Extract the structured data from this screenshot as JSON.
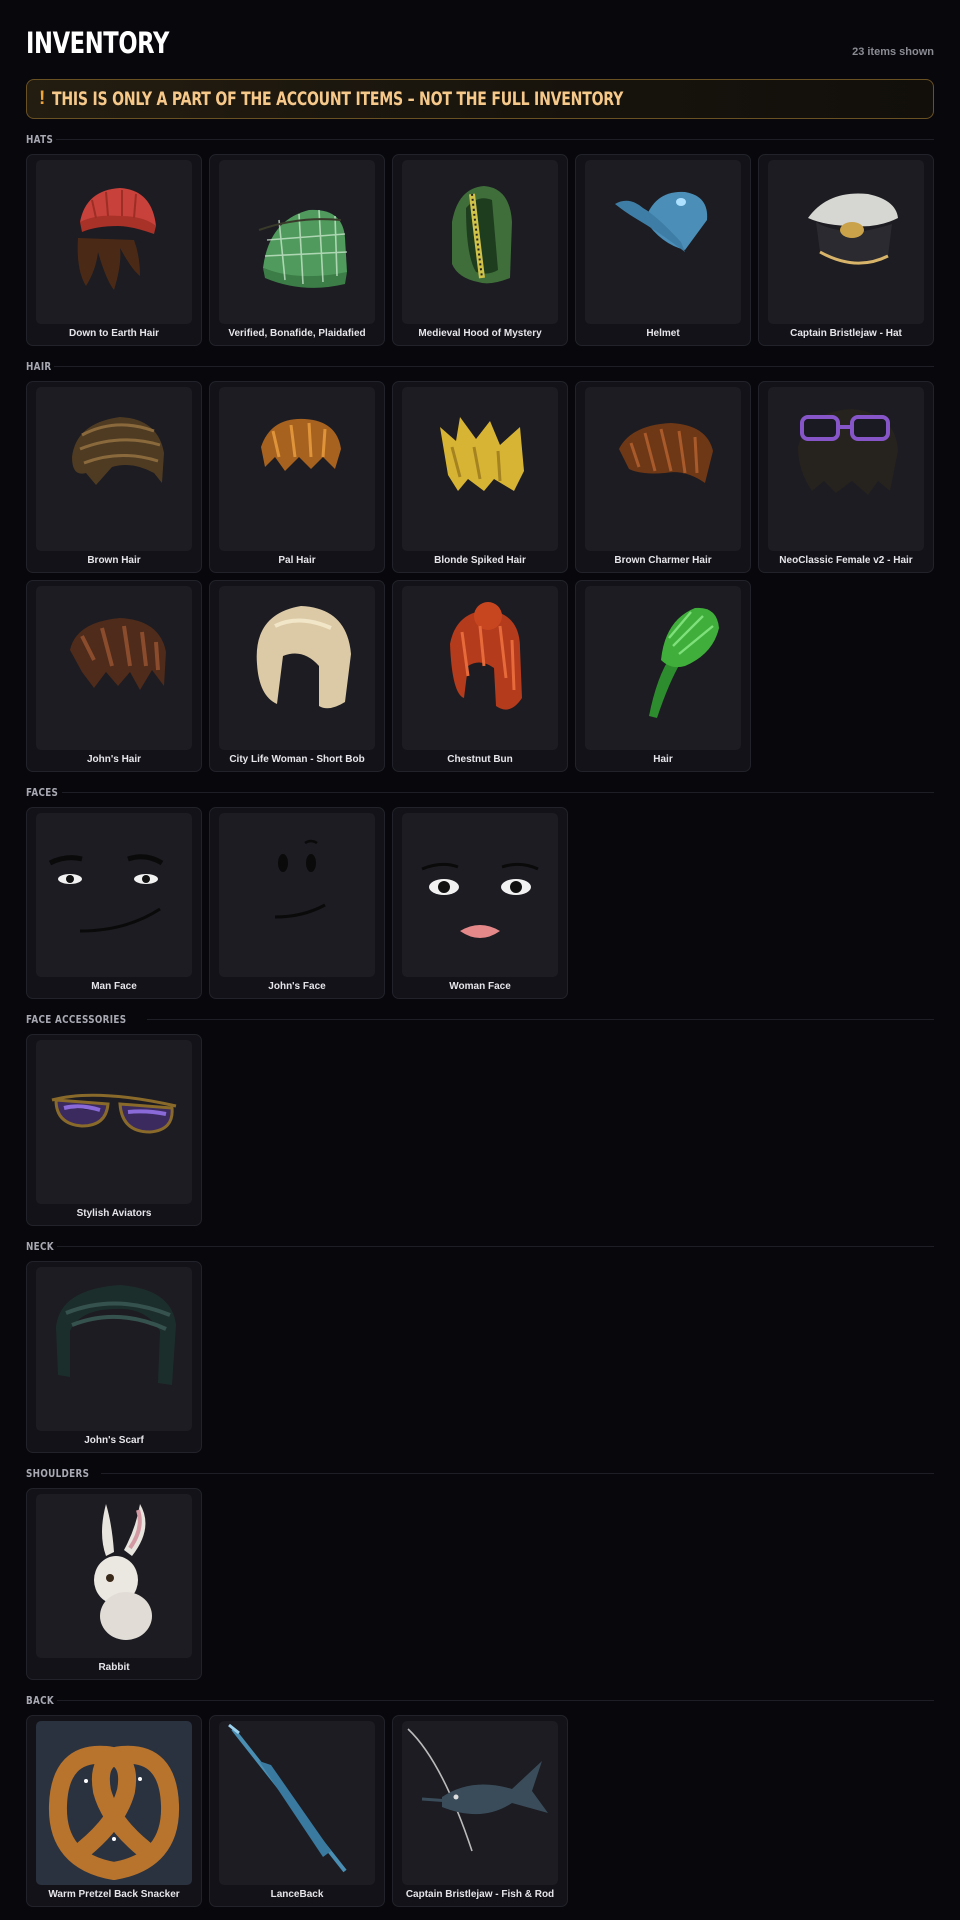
{
  "header": {
    "title": "INVENTORY",
    "count": "23 items shown"
  },
  "banner": {
    "icon": "!",
    "message": "THIS IS ONLY A PART OF THE ACCOUNT ITEMS – NOT THE FULL INVENTORY"
  },
  "sections": [
    {
      "label": "HATS",
      "items": [
        {
          "name": "Down to Earth Hair",
          "icon": "red-beanie-hair-icon"
        },
        {
          "name": "Verified, Bonafide, Plaidafied",
          "icon": "plaid-cap-icon"
        },
        {
          "name": "Medieval Hood of Mystery",
          "icon": "green-hood-icon"
        },
        {
          "name": "Helmet",
          "icon": "blue-helmet-icon"
        },
        {
          "name": "Captain Bristlejaw - Hat",
          "icon": "captain-hat-icon"
        }
      ]
    },
    {
      "label": "HAIR",
      "items": [
        {
          "name": "Brown Hair",
          "icon": "brown-hair-icon"
        },
        {
          "name": "Pal Hair",
          "icon": "pal-hair-icon"
        },
        {
          "name": "Blonde Spiked Hair",
          "icon": "blonde-spiked-hair-icon"
        },
        {
          "name": "Brown Charmer Hair",
          "icon": "charmer-hair-icon"
        },
        {
          "name": "NeoClassic Female v2 - Hair",
          "icon": "neoclassic-hair-icon"
        },
        {
          "name": "John's Hair",
          "icon": "johns-hair-icon"
        },
        {
          "name": "City Life Woman - Short Bob",
          "icon": "short-bob-icon"
        },
        {
          "name": "Chestnut Bun",
          "icon": "chestnut-bun-icon"
        },
        {
          "name": "Hair",
          "icon": "green-hair-icon"
        }
      ]
    },
    {
      "label": "FACES",
      "items": [
        {
          "name": "Man Face",
          "icon": "man-face-icon"
        },
        {
          "name": "John's Face",
          "icon": "johns-face-icon"
        },
        {
          "name": "Woman Face",
          "icon": "woman-face-icon"
        }
      ]
    },
    {
      "label": "FACE ACCESSORIES",
      "items": [
        {
          "name": "Stylish Aviators",
          "icon": "aviators-icon"
        }
      ]
    },
    {
      "label": "NECK",
      "items": [
        {
          "name": "John's Scarf",
          "icon": "scarf-icon"
        }
      ]
    },
    {
      "label": "SHOULDERS",
      "items": [
        {
          "name": "Rabbit",
          "icon": "rabbit-icon"
        }
      ]
    },
    {
      "label": "BACK",
      "items": [
        {
          "name": "Warm Pretzel Back Snacker",
          "icon": "pretzel-icon"
        },
        {
          "name": "LanceBack",
          "icon": "lance-icon"
        },
        {
          "name": "Captain Bristlejaw - Fish & Rod",
          "icon": "fish-rod-icon"
        }
      ]
    }
  ]
}
